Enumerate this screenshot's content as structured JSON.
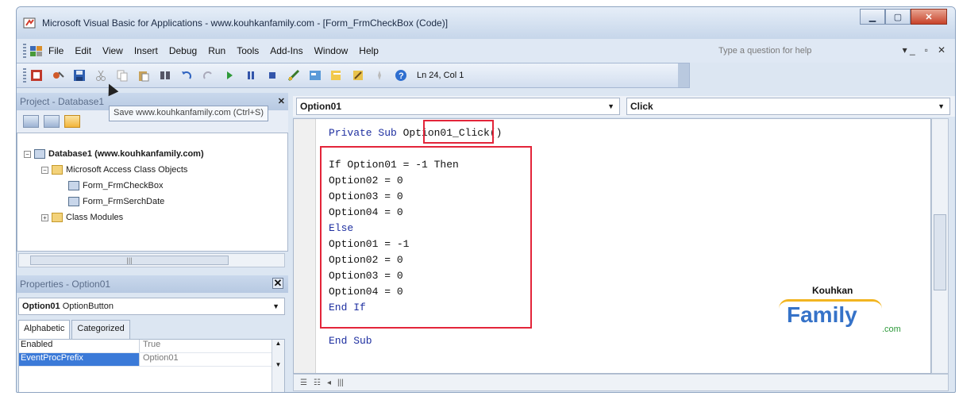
{
  "window": {
    "title": "Microsoft Visual Basic for Applications - www.kouhkanfamily.com - [Form_FrmCheckBox (Code)]"
  },
  "menu": {
    "items": [
      "File",
      "Edit",
      "View",
      "Insert",
      "Debug",
      "Run",
      "Tools",
      "Add-Ins",
      "Window",
      "Help"
    ],
    "help_placeholder": "Type a question for help"
  },
  "toolbar": {
    "position": "Ln 24, Col 1",
    "tooltip": "Save www.kouhkanfamily.com (Ctrl+S)"
  },
  "project": {
    "title": "Project - Database1",
    "tree": {
      "root": "Database1 (www.kouhkanfamily.com)",
      "folder_access": "Microsoft Access Class Objects",
      "form1": "Form_FrmCheckBox",
      "form2": "Form_FrmSerchDate",
      "folder_modules": "Class Modules"
    }
  },
  "properties": {
    "title": "Properties - Option01",
    "object_name": "Option01",
    "object_type": "OptionButton",
    "tabs": [
      "Alphabetic",
      "Categorized"
    ],
    "rows": [
      {
        "key": "Enabled",
        "value": "True"
      },
      {
        "key": "EventProcPrefix",
        "value": "Option01"
      }
    ]
  },
  "code": {
    "object_combo": "Option01",
    "proc_combo": "Click",
    "line_sub_pre": "Private Sub ",
    "line_sub_name": "Option01",
    "line_sub_post": "_Click()",
    "lines": [
      "If Option01 = -1 Then",
      "Option02 = 0",
      "Option03 = 0",
      "Option04 = 0",
      "Else",
      "Option01 = -1",
      "Option02 = 0",
      "Option03 = 0",
      "Option04 = 0",
      "End If"
    ],
    "end_sub": "End Sub"
  },
  "logo": {
    "top": "Kouhkan",
    "main": "Family",
    "com": ".com"
  },
  "colors": {
    "highlight": "#e3253a",
    "keyword": "#1e2fa0"
  }
}
